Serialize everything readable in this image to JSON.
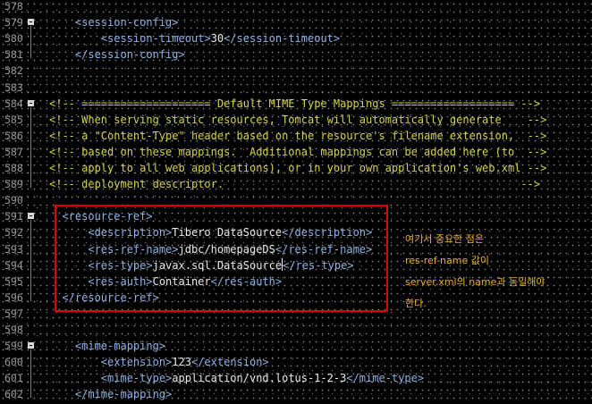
{
  "editor": {
    "lines": [
      {
        "num": "578",
        "fold": false,
        "parts": []
      },
      {
        "num": "579",
        "fold": true,
        "parts": [
          {
            "c": "tag",
            "t": "    <session-config>"
          }
        ]
      },
      {
        "num": "580",
        "fold": false,
        "parts": [
          {
            "c": "tag",
            "t": "        <session-timeout>"
          },
          {
            "c": "txt",
            "t": "30"
          },
          {
            "c": "tag",
            "t": "</session-timeout>"
          }
        ]
      },
      {
        "num": "581",
        "fold": false,
        "parts": [
          {
            "c": "tag",
            "t": "    </session-config>"
          }
        ]
      },
      {
        "num": "582",
        "fold": false,
        "parts": []
      },
      {
        "num": "583",
        "fold": false,
        "parts": []
      },
      {
        "num": "584",
        "fold": true,
        "parts": [
          {
            "c": "cmt",
            "t": "<!-- ==================== Default MIME Type Mappings =================== -->"
          }
        ]
      },
      {
        "num": "585",
        "fold": false,
        "parts": [
          {
            "c": "cmt",
            "t": "<!-- When serving static resources, Tomcat will automatically generate    -->"
          }
        ]
      },
      {
        "num": "586",
        "fold": false,
        "parts": [
          {
            "c": "cmt",
            "t": "<!-- a \"Content-Type\" header based on the resource's filename extension,  -->"
          }
        ]
      },
      {
        "num": "587",
        "fold": false,
        "parts": [
          {
            "c": "cmt",
            "t": "<!-- based on these mappings.  Additional mappings can be added here (to  -->"
          }
        ]
      },
      {
        "num": "588",
        "fold": false,
        "parts": [
          {
            "c": "cmt",
            "t": "<!-- apply to all web applications), or in your own application's web.xml -->"
          }
        ]
      },
      {
        "num": "589",
        "fold": false,
        "parts": [
          {
            "c": "cmt",
            "t": "<!-- deployment descriptor.                                              -->"
          }
        ]
      },
      {
        "num": "590",
        "fold": false,
        "parts": []
      },
      {
        "num": "591",
        "fold": true,
        "parts": [
          {
            "c": "tag",
            "t": "  <resource-ref>"
          }
        ]
      },
      {
        "num": "592",
        "fold": false,
        "parts": [
          {
            "c": "tag",
            "t": "      <description>"
          },
          {
            "c": "txt",
            "t": "Tibero DataSource"
          },
          {
            "c": "tag",
            "t": "</description>"
          }
        ]
      },
      {
        "num": "593",
        "fold": false,
        "parts": [
          {
            "c": "tag",
            "t": "      <res-ref-name>"
          },
          {
            "c": "txt",
            "t": "jdbc/homepageDS"
          },
          {
            "c": "tag",
            "t": "</res-ref-name>"
          }
        ]
      },
      {
        "num": "594",
        "fold": false,
        "parts": [
          {
            "c": "tag",
            "t": "      <res-type>"
          },
          {
            "c": "txt",
            "t": "javax.sql.DataSource"
          },
          {
            "c": "caret",
            "t": ""
          },
          {
            "c": "tag",
            "t": "</res-type>"
          }
        ]
      },
      {
        "num": "595",
        "fold": false,
        "parts": [
          {
            "c": "tag",
            "t": "      <res-auth>"
          },
          {
            "c": "txt",
            "t": "Container"
          },
          {
            "c": "tag",
            "t": "</res-auth>"
          }
        ]
      },
      {
        "num": "596",
        "fold": false,
        "parts": [
          {
            "c": "tag",
            "t": "  </resource-ref>"
          }
        ]
      },
      {
        "num": "597",
        "fold": false,
        "parts": []
      },
      {
        "num": "598",
        "fold": false,
        "parts": []
      },
      {
        "num": "599",
        "fold": true,
        "parts": [
          {
            "c": "tag",
            "t": "    <mime-mapping>"
          }
        ]
      },
      {
        "num": "600",
        "fold": false,
        "parts": [
          {
            "c": "tag",
            "t": "        <extension>"
          },
          {
            "c": "txt",
            "t": "123"
          },
          {
            "c": "tag",
            "t": "</extension>"
          }
        ]
      },
      {
        "num": "601",
        "fold": false,
        "parts": [
          {
            "c": "tag",
            "t": "        <mime-type>"
          },
          {
            "c": "txt",
            "t": "application/vnd.lotus-1-2-3"
          },
          {
            "c": "tag",
            "t": "</mime-type>"
          }
        ]
      },
      {
        "num": "602",
        "fold": false,
        "parts": [
          {
            "c": "tag",
            "t": "    </mime-mapping>"
          }
        ]
      }
    ]
  },
  "annotation": {
    "lines": [
      "여기서 중요한 점은",
      "res-ref-name 값이",
      "server.xml의 name과 동일해야",
      "한다."
    ],
    "box_color": "#e10000",
    "text_color": "#f2b21b"
  },
  "colors": {
    "background": "#000000",
    "tag": "#8fb4e8",
    "comment": "#d6d63a",
    "text": "#ececec",
    "line_number": "#9a9a9a"
  }
}
